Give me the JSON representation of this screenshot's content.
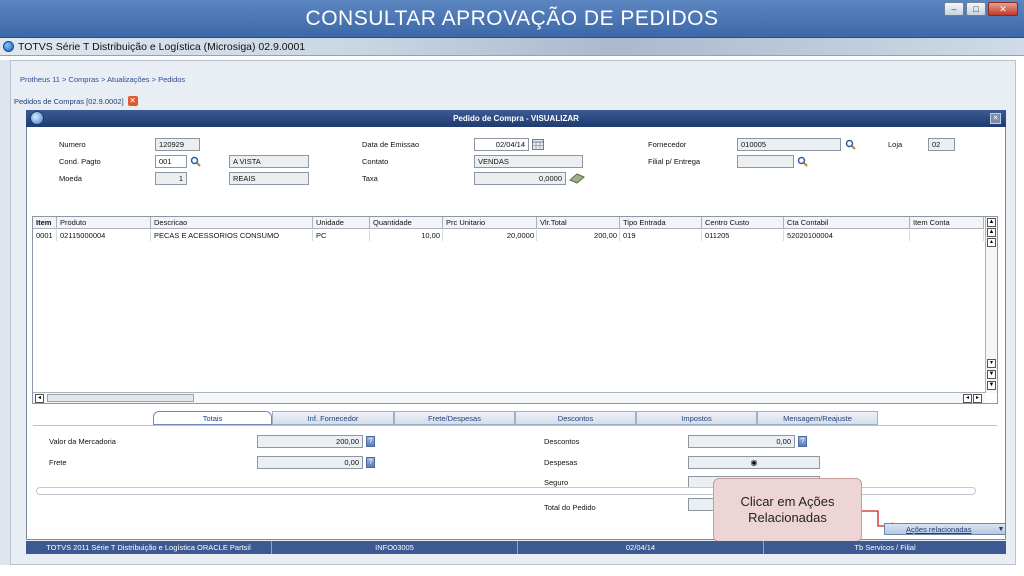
{
  "slide": {
    "title": "CONSULTAR APROVAÇÃO DE PEDIDOS"
  },
  "window": {
    "title": "TOTVS Série T Distribuição e Logística (Microsiga) 02.9.0001"
  },
  "breadcrumb": "Protheus 11 > Compras  > Atualizações > Pedidos",
  "tab_path": "Pedidos de Compras [02.9.0002]",
  "dialog": {
    "title": "Pedido de Compra - VISUALIZAR"
  },
  "header_fields": {
    "numero": {
      "label": "Numero",
      "value": "120929"
    },
    "cond_pagto": {
      "label": "Cond. Pagto",
      "value": "001",
      "desc": "A VISTA"
    },
    "moeda": {
      "label": "Moeda",
      "value": "1",
      "desc": "REAIS"
    },
    "data_emissao": {
      "label": "Data de Emissao",
      "value": "02/04/14"
    },
    "contato": {
      "label": "Contato",
      "value": "VENDAS"
    },
    "taxa": {
      "label": "Taxa",
      "value": "0,0000"
    },
    "fornecedor": {
      "label": "Fornecedor",
      "value": "010005"
    },
    "loja": {
      "label": "Loja",
      "value": "02"
    },
    "filial_entrega": {
      "label": "Filial p/ Entrega",
      "value": ""
    }
  },
  "grid": {
    "columns": [
      "Item",
      "Produto",
      "Descricao",
      "Unidade",
      "Quantidade",
      "Prc Unitario",
      "Vlr.Total",
      "Tipo Entrada",
      "Centro Custo",
      "Cta Contabil",
      "Item Conta"
    ],
    "rows": [
      [
        "0001",
        "02115000004",
        "PECAS E ACESSORIOS CONSUMO",
        "PC",
        "10,00",
        "20,0000",
        "200,00",
        "019",
        "011205",
        "52020100004",
        ""
      ]
    ]
  },
  "tabs": [
    "Totais",
    "Inf. Fornecedor",
    "Frete/Despesas",
    "Descontos",
    "Impostos",
    "Mensagem/Reajuste"
  ],
  "totals": {
    "valor_mercadoria": {
      "label": "Valor da Mercadoria",
      "value": "200,00"
    },
    "frete": {
      "label": "Frete",
      "value": "0,00"
    },
    "descontos": {
      "label": "Descontos",
      "value": "0,00"
    },
    "despesas": {
      "label": "Despesas",
      "value": ""
    },
    "seguro": {
      "label": "Seguro",
      "value": ""
    },
    "total_pedido": {
      "label": "Total do Pedido",
      "value": ""
    }
  },
  "callout": {
    "line1": "Clicar em Ações",
    "line2": "Relacionadas"
  },
  "acoes_button": "Ações relacionadas",
  "statusbar": [
    "TOTVS 2011 Série T Distribuição e Logística ORACLE Partsil",
    "INFO03005",
    "02/04/14",
    "Tb Servicos / Filial"
  ],
  "colors": {
    "banner": "#4a77b6",
    "dialog_title": "#1f3a6e",
    "callout_bg": "#eed5d5",
    "statusbar": "#3c5a91"
  },
  "icons": [
    "search-icon",
    "calendar-icon",
    "eraser-icon",
    "close-icon",
    "help-icon"
  ]
}
